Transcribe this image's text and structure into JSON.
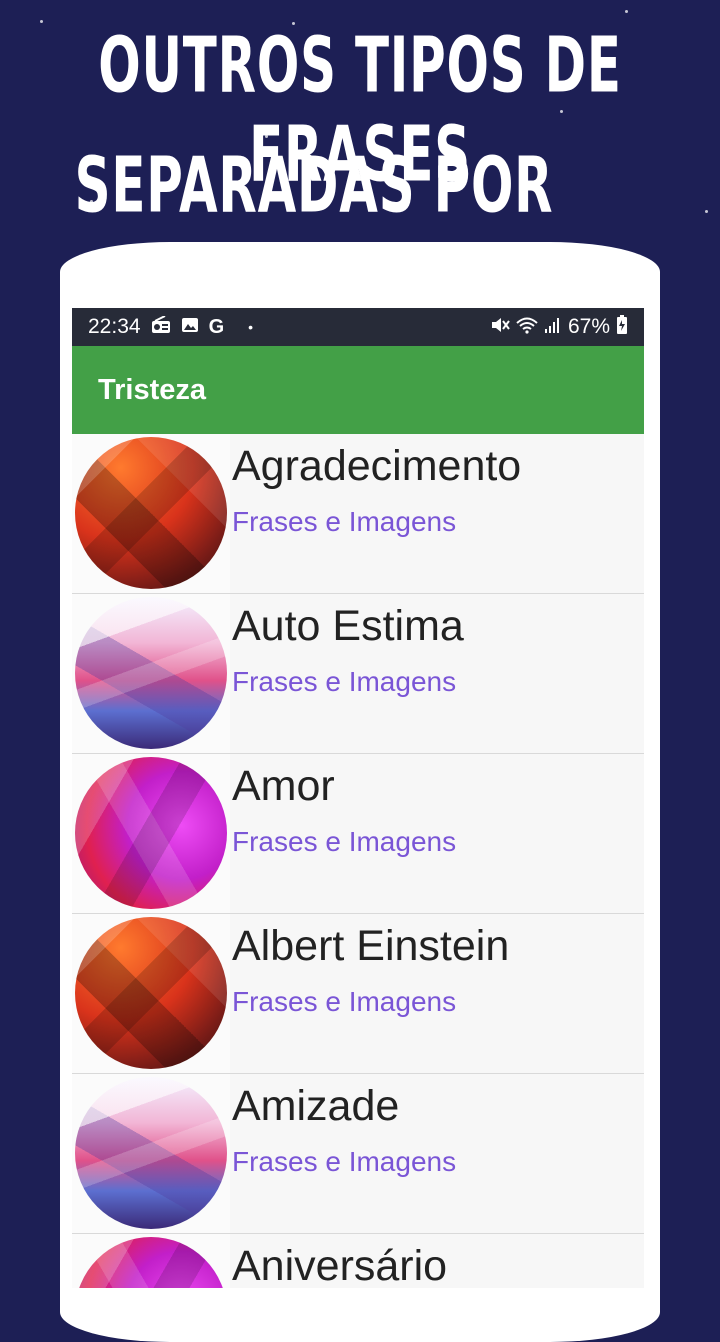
{
  "promo": {
    "line1": "OUTROS TIPOS DE FRASES",
    "line2": "SEPARADAS POR TIPO"
  },
  "status_bar": {
    "time": "22:34",
    "battery": "67%"
  },
  "app_bar": {
    "title": "Tristeza"
  },
  "categories": [
    {
      "title": "Agradecimento",
      "subtitle": "Frases e Imagens",
      "image": "orange-lowpoly"
    },
    {
      "title": "Auto Estima",
      "subtitle": "Frases e Imagens",
      "image": "pastel-lowpoly"
    },
    {
      "title": "Amor",
      "subtitle": "Frases e Imagens",
      "image": "magenta-lowpoly"
    },
    {
      "title": "Albert Einstein",
      "subtitle": "Frases e Imagens",
      "image": "orange-lowpoly"
    },
    {
      "title": "Amizade",
      "subtitle": "Frases e Imagens",
      "image": "pastel-lowpoly"
    },
    {
      "title": "Aniversário",
      "subtitle": "",
      "image": "magenta-lowpoly"
    }
  ],
  "colors": {
    "background": "#1d1f55",
    "app_bar": "#43a047",
    "status_bar": "#272b38",
    "subtitle": "#7a55d6"
  }
}
